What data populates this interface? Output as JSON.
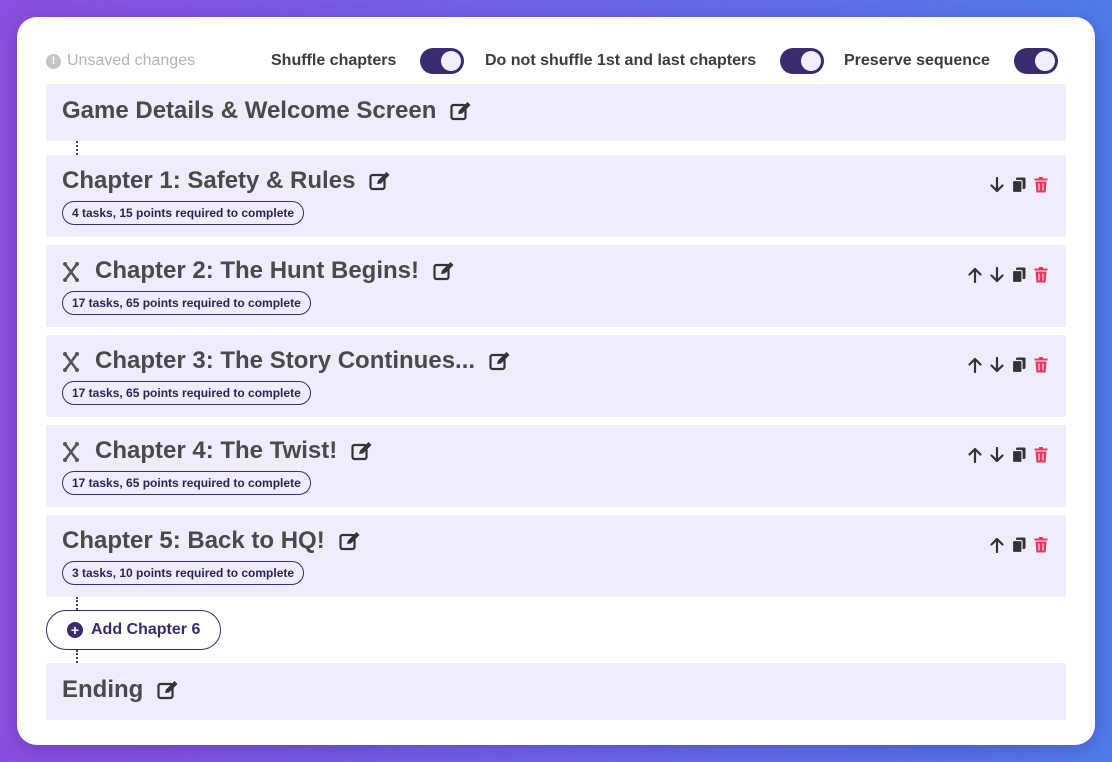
{
  "status": {
    "unsaved_label": "Unsaved changes"
  },
  "toggles": [
    {
      "label": "Shuffle chapters",
      "on": true
    },
    {
      "label": "Do not shuffle 1st and last chapters",
      "on": true
    },
    {
      "label": "Preserve sequence",
      "on": true
    }
  ],
  "intro": {
    "title": "Game Details & Welcome Screen"
  },
  "chapters": [
    {
      "title": "Chapter 1: Safety & Rules",
      "badge": "4 tasks, 15 points required to complete",
      "draggable": false,
      "can_move_up": false,
      "can_move_down": true
    },
    {
      "title": "Chapter 2: The Hunt Begins!",
      "badge": "17 tasks, 65 points required to complete",
      "draggable": true,
      "can_move_up": true,
      "can_move_down": true
    },
    {
      "title": "Chapter 3: The Story Continues...",
      "badge": "17 tasks, 65 points required to complete",
      "draggable": true,
      "can_move_up": true,
      "can_move_down": true
    },
    {
      "title": "Chapter 4: The Twist!",
      "badge": "17 tasks, 65 points required to complete",
      "draggable": true,
      "can_move_up": true,
      "can_move_down": true
    },
    {
      "title": "Chapter 5: Back to HQ!",
      "badge": "3 tasks, 10 points required to complete",
      "draggable": false,
      "can_move_up": true,
      "can_move_down": false
    }
  ],
  "add_chapter": {
    "label": "Add Chapter 6"
  },
  "ending": {
    "title": "Ending"
  },
  "colors": {
    "accent": "#3a2a6e",
    "section_bg": "#efecfd",
    "delete": "#e8375f",
    "icon": "#333333"
  },
  "icons": {
    "edit": "edit-icon",
    "drag": "drag-handle-icon",
    "up": "arrow-up-icon",
    "down": "arrow-down-icon",
    "copy": "copy-icon",
    "delete": "trash-icon",
    "add": "plus-circle-icon",
    "info": "exclamation-circle-icon"
  }
}
